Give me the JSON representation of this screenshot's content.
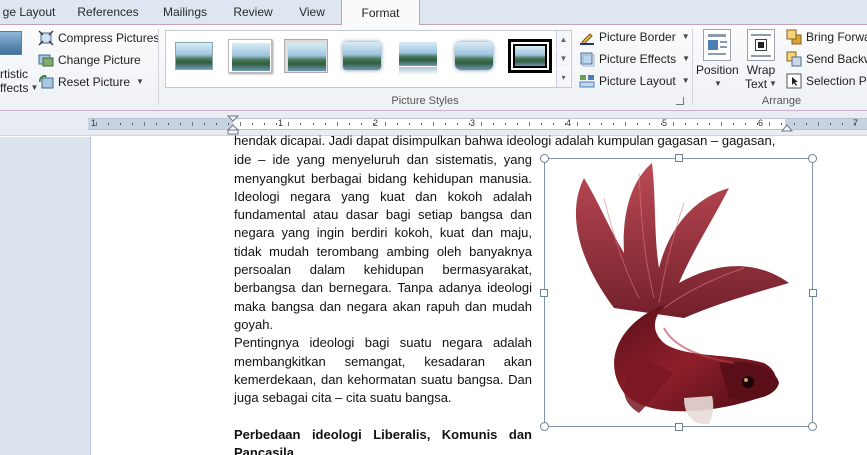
{
  "tabs": [
    "ge Layout",
    "References",
    "Mailings",
    "Review",
    "View",
    "Format"
  ],
  "active_tab": "Format",
  "ribbon": {
    "adjust": {
      "artistic_line1": "rtistic",
      "artistic_line2": "ffects",
      "compress": "Compress Pictures",
      "change": "Change Picture",
      "reset": "Reset Picture"
    },
    "picture_styles": {
      "label": "Picture Styles",
      "border": "Picture Border",
      "effects": "Picture Effects",
      "layout": "Picture Layout"
    },
    "arrange": {
      "label": "Arrange",
      "position": "Position",
      "wrap_line1": "Wrap",
      "wrap_line2": "Text",
      "bring_forward": "Bring Forwa",
      "send_backward": "Send Backw",
      "selection_pane": "Selection Pa"
    }
  },
  "ruler": {
    "numbers": [
      "1",
      "1",
      "2",
      "3",
      "4",
      "5",
      "6",
      "7"
    ]
  },
  "document": {
    "first_line": "hendak dicapai. Jadi dapat disimpulkan bahwa ideologi adalah kumpulan gagasan – gagasan,",
    "paragraph1": "ide – ide yang menyeluruh dan sistematis, yang menyangkut berbagai bidang kehidupan manusia. Ideologi negara yang kuat dan kokoh adalah fundamental atau dasar bagi setiap bangsa dan negara yang ingin berdiri kokoh, kuat dan maju, tidak mudah terombang ambing oleh banyaknya persoalan dalam kehidupan bermasyarakat, berbangsa dan bernegara. Tanpa adanya ideologi maka bangsa dan negara akan rapuh dan mudah goyah.",
    "paragraph2": "Pentingnya ideologi bagi suatu negara adalah membangkitkan semangat, kesadaran akan kemerdekaan, dan kehormatan suatu bangsa. Dan juga sebagai cita – cita suatu bangsa.",
    "heading": "Perbedaan ideologi Liberalis, Komunis dan Pancasila."
  },
  "colors": {
    "tab_active_border": "#c59ac0",
    "fish_dark": "#5a0f18",
    "fish_mid": "#8e1f2a",
    "fish_light": "#b8414b"
  }
}
